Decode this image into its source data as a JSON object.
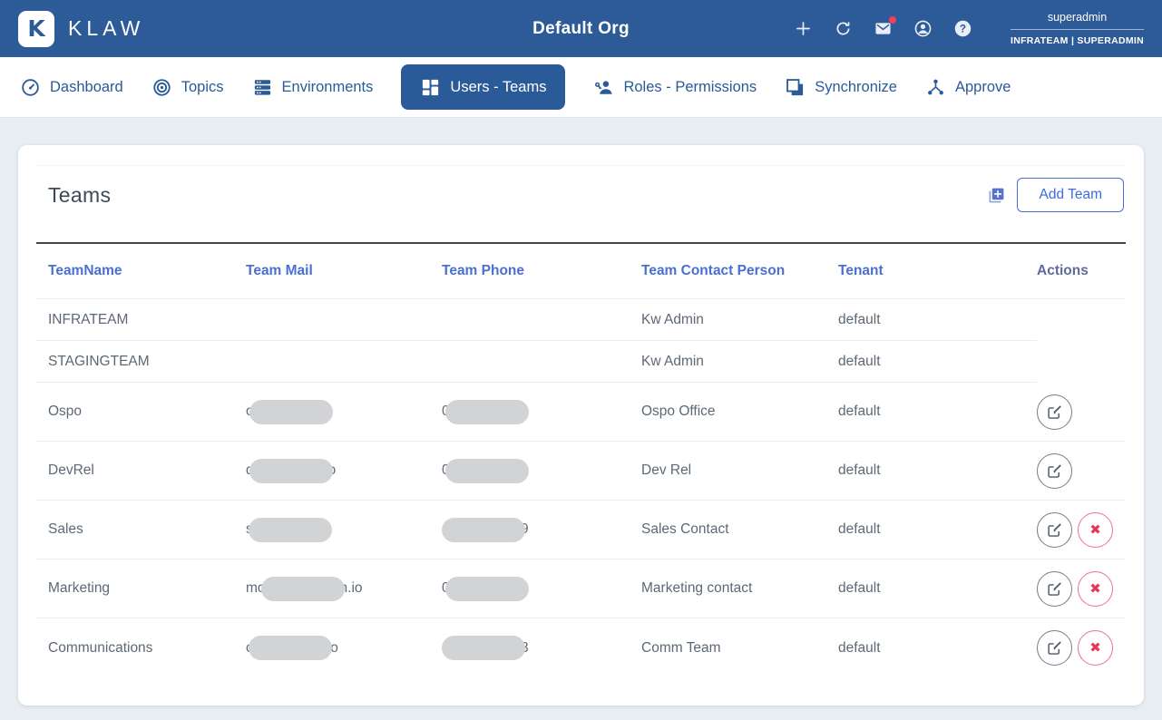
{
  "header": {
    "brand": "KLAW",
    "logo_letter": "K",
    "org_title": "Default Org",
    "username": "superadmin",
    "user_role": "INFRATEAM | SUPERADMIN",
    "icons": {
      "add": "plus-icon",
      "refresh": "refresh-icon",
      "mail": "mail-icon-with-unread-badge",
      "account": "account-circle-icon",
      "help": "help-icon",
      "help_glyph": "?"
    }
  },
  "nav": {
    "items": [
      {
        "label": "Dashboard",
        "icon": "gauge-icon",
        "active": false
      },
      {
        "label": "Topics",
        "icon": "bullseye-icon",
        "active": false
      },
      {
        "label": "Environments",
        "icon": "server-stack-icon",
        "active": false
      },
      {
        "label": "Users - Teams",
        "icon": "dashboard-grid-icon",
        "active": true
      },
      {
        "label": "Roles - Permissions",
        "icon": "person-key-icon",
        "active": false
      },
      {
        "label": "Synchronize",
        "icon": "layered-squares-icon",
        "active": false
      },
      {
        "label": "Approve",
        "icon": "hub-icon",
        "active": false
      }
    ]
  },
  "teams_panel": {
    "title": "Teams",
    "add_button_label": "Add Team",
    "add_button_icon": "library-add-icon",
    "table": {
      "headers": [
        "TeamName",
        "Team Mail",
        "Team Phone",
        "Team Contact Person",
        "Tenant",
        "Actions"
      ],
      "delete_glyph": "✖",
      "rows": [
        {
          "name": "INFRATEAM",
          "mail": null,
          "phone": null,
          "contact": "Kw Admin",
          "tenant": "default",
          "actions": {
            "edit": false,
            "delete": false
          },
          "compact": true
        },
        {
          "name": "STAGINGTEAM",
          "mail": null,
          "phone": null,
          "contact": "Kw Admin",
          "tenant": "default",
          "actions": {
            "edit": false,
            "delete": false
          },
          "compact": true
        },
        {
          "name": "Ospo",
          "mail": {
            "pre": "o",
            "redacted": true,
            "post": ""
          },
          "phone": {
            "pre": "0",
            "redacted": true,
            "post": ""
          },
          "contact": "Ospo Office",
          "tenant": "default",
          "actions": {
            "edit": true,
            "delete": false
          },
          "compact": false
        },
        {
          "name": "DevRel",
          "mail": {
            "pre": "d",
            "redacted": true,
            "post": "o"
          },
          "phone": {
            "pre": "0",
            "redacted": true,
            "post": ""
          },
          "contact": "Dev Rel",
          "tenant": "default",
          "actions": {
            "edit": true,
            "delete": false
          },
          "compact": false
        },
        {
          "name": "Sales",
          "mail": {
            "pre": "s",
            "redacted": true,
            "post": ""
          },
          "phone": {
            "pre": "",
            "redacted": true,
            "post": "9"
          },
          "contact": "Sales Contact",
          "tenant": "default",
          "actions": {
            "edit": true,
            "delete": true
          },
          "compact": false
        },
        {
          "name": "Marketing",
          "mail": {
            "pre": "mo",
            "redacted": true,
            "post": "n.io"
          },
          "phone": {
            "pre": "0",
            "redacted": true,
            "post": ""
          },
          "contact": "Marketing contact",
          "tenant": "default",
          "actions": {
            "edit": true,
            "delete": true
          },
          "compact": false
        },
        {
          "name": "Communications",
          "mail": {
            "pre": "c",
            "redacted": true,
            "post": "io"
          },
          "phone": {
            "pre": "",
            "redacted": true,
            "post": "3"
          },
          "contact": "Comm Team",
          "tenant": "default",
          "actions": {
            "edit": true,
            "delete": true
          },
          "compact": false
        }
      ]
    }
  },
  "colors": {
    "header_bg": "#2d5b98",
    "nav_blue": "#2a5a98",
    "table_header_blue": "#4a6fd4",
    "delete_red": "#e93853",
    "redaction_gray": "#d2d3d5",
    "page_bg": "#e9eef3"
  }
}
